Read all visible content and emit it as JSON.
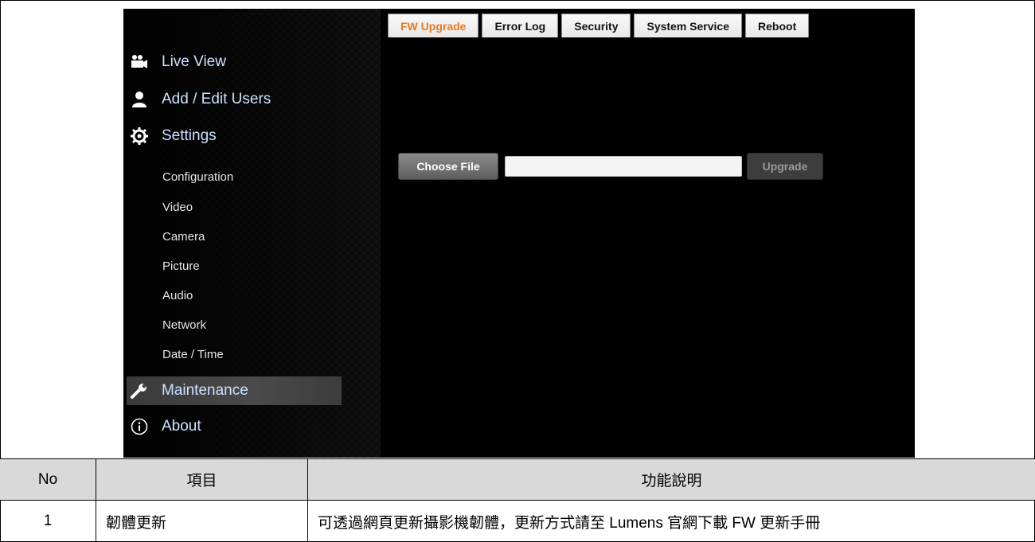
{
  "sidebar": {
    "main_items": [
      {
        "label": "Live View",
        "icon": "video-camera-icon"
      },
      {
        "label": "Add / Edit Users",
        "icon": "user-icon"
      },
      {
        "label": "Settings",
        "icon": "gear-icon"
      },
      {
        "label": "Maintenance",
        "icon": "wrench-icon"
      },
      {
        "label": "About",
        "icon": "info-icon"
      }
    ],
    "sub_items": [
      "Configuration",
      "Video",
      "Camera",
      "Picture",
      "Audio",
      "Network",
      "Date / Time"
    ],
    "active_item": "Maintenance"
  },
  "tabs": [
    {
      "label": "FW Upgrade",
      "active": true
    },
    {
      "label": "Error Log",
      "active": false
    },
    {
      "label": "Security",
      "active": false
    },
    {
      "label": "System Service",
      "active": false
    },
    {
      "label": "Reboot",
      "active": false
    }
  ],
  "upgrade": {
    "choose_file_label": "Choose File",
    "file_value": "",
    "upgrade_label": "Upgrade"
  },
  "table": {
    "headers": [
      "No",
      "項目",
      "功能說明"
    ],
    "rows": [
      {
        "no": "1",
        "item": "韌體更新",
        "desc": "可透過網頁更新攝影機韌體，更新方式請至 Lumens 官網下載 FW 更新手冊"
      }
    ]
  },
  "colors": {
    "active_tab_text": "#e87a1e",
    "nav_text": "#cde2ff",
    "header_bg": "#d9d9d9"
  }
}
